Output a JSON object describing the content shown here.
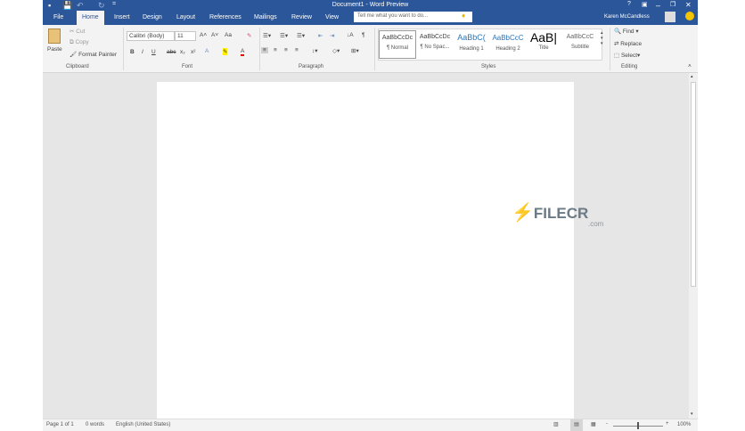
{
  "window": {
    "title": "Document1 - Word Preview",
    "user": "Karen McCandless",
    "help": "?",
    "minimize": "–",
    "restore": "❐",
    "close": "✕"
  },
  "quick_access": {
    "save": "💾",
    "undo": "↶",
    "redo": "↻",
    "customize": "="
  },
  "tabs": [
    "File",
    "Home",
    "Insert",
    "Design",
    "Layout",
    "References",
    "Mailings",
    "Review",
    "View"
  ],
  "tell_me": {
    "placeholder": "Tell me what you want to do..."
  },
  "clipboard": {
    "paste": "Paste",
    "cut": "Cut",
    "copy": "Copy",
    "format_painter": "Format Painter",
    "label": "Clipboard"
  },
  "font": {
    "name": "Calibri (Body)",
    "size": "11",
    "grow": "A˄",
    "shrink": "A˅",
    "case": "Aa",
    "bold": "B",
    "italic": "I",
    "underline": "U",
    "strike": "abc",
    "sub": "x₂",
    "sup": "x²",
    "label": "Font"
  },
  "paragraph": {
    "label": "Paragraph",
    "pilcrow": "¶",
    "sort": "↓A"
  },
  "styles": {
    "label": "Styles",
    "items": [
      {
        "sample": "AaBbCcDc",
        "name": "¶ Normal"
      },
      {
        "sample": "AaBbCcDc",
        "name": "¶ No Spac..."
      },
      {
        "sample": "AaBbC(",
        "name": "Heading 1"
      },
      {
        "sample": "AaBbCcC",
        "name": "Heading 2"
      },
      {
        "sample": "AaB|",
        "name": "Title"
      },
      {
        "sample": "AaBbCcC",
        "name": "Subtitle"
      }
    ]
  },
  "editing": {
    "find": "Find",
    "replace": "Replace",
    "select": "Select",
    "label": "Editing"
  },
  "watermark": {
    "brand": "FILECR",
    "suffix": ".com"
  },
  "status": {
    "page": "Page 1 of 1",
    "words": "0 words",
    "language": "English (United States)",
    "zoom": "100%",
    "zoom_minus": "-",
    "zoom_plus": "+"
  }
}
